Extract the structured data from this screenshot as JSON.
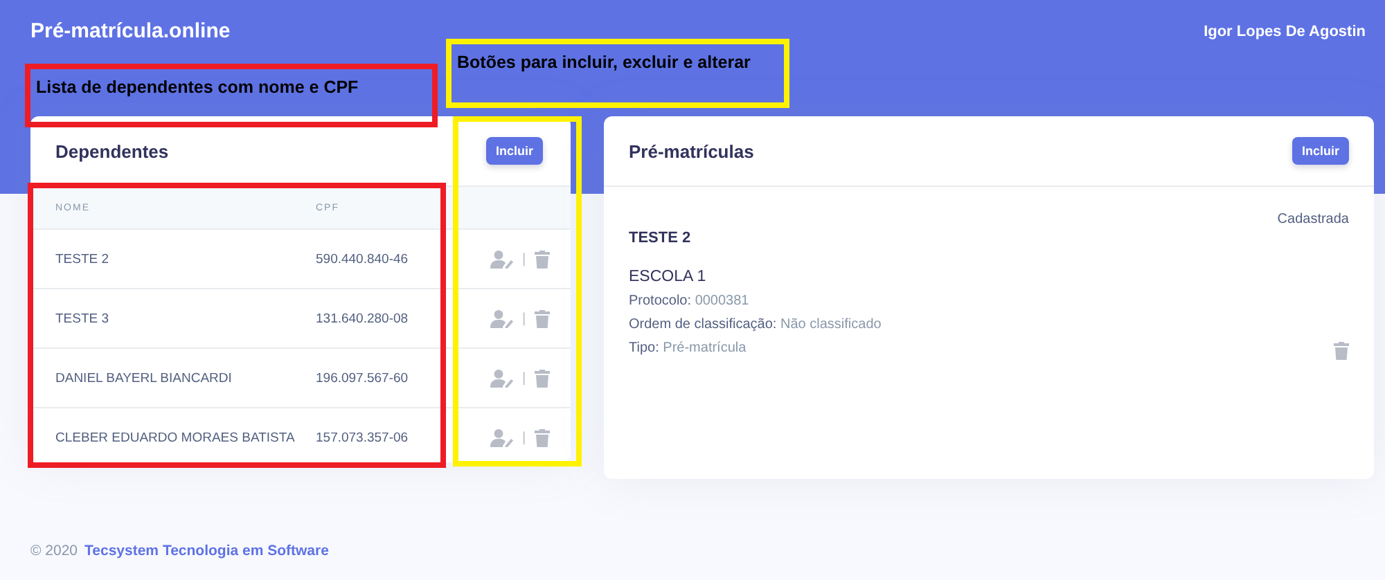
{
  "brand": "Pré-matrícula.online",
  "user": "Igor Lopes De Agostin",
  "dependents": {
    "title": "Dependentes",
    "add_button": "Incluir",
    "columns": [
      "NOME",
      "CPF"
    ],
    "rows": [
      {
        "name": "TESTE 2",
        "cpf": "590.440.840-46"
      },
      {
        "name": "TESTE 3",
        "cpf": "131.640.280-08"
      },
      {
        "name": "DANIEL BAYERL BIANCARDI",
        "cpf": "196.097.567-60"
      },
      {
        "name": "CLEBER EDUARDO MORAES BATISTA",
        "cpf": "157.073.357-06"
      }
    ],
    "separator": "|"
  },
  "enrollments": {
    "title": "Pré-matrículas",
    "add_button": "Incluir",
    "items": [
      {
        "status": "Cadastrada",
        "student": "TESTE 2",
        "school": "ESCOLA 1",
        "details": [
          {
            "label": "Protocolo:",
            "value": "0000381"
          },
          {
            "label": "Ordem de classificação:",
            "value": "Não classificado"
          },
          {
            "label": "Tipo:",
            "value": "Pré-matrícula"
          }
        ]
      }
    ]
  },
  "footer": {
    "copyright": "© 2020",
    "link": "Tecsystem Tecnologia em Software"
  },
  "annotations": [
    {
      "text": "Lista de dependentes com nome e CPF",
      "color": "#ee1c25"
    },
    {
      "text": "Botões para incluir, excluir e alterar",
      "color": "#fff200"
    },
    {
      "color": "#ee1c25"
    },
    {
      "color": "#fff200"
    }
  ]
}
